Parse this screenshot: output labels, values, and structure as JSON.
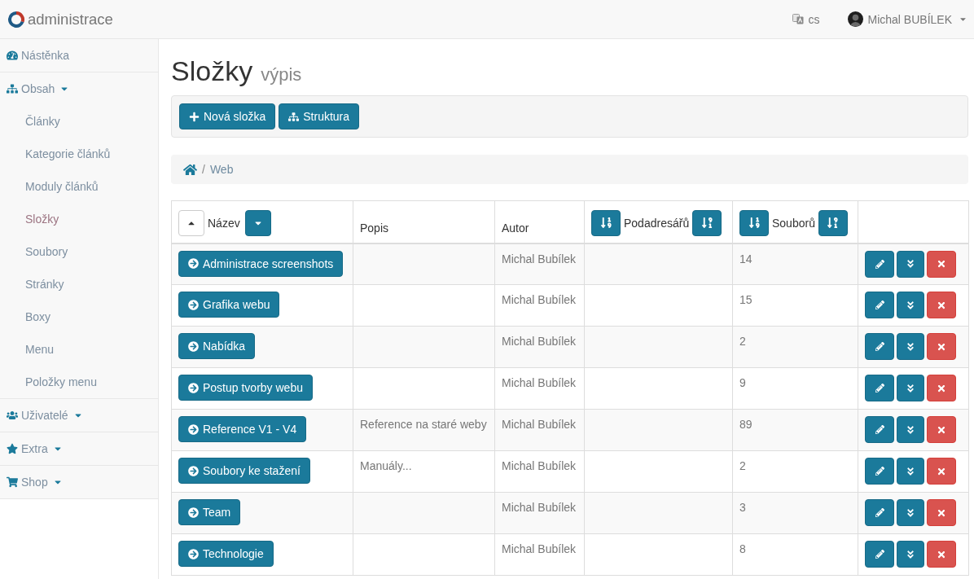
{
  "navbar": {
    "brand": "administrace",
    "language": "cs",
    "user": "Michal BUBÍLEK"
  },
  "sidebar": {
    "items": [
      {
        "label": "Nástěnka",
        "kind": "link"
      },
      {
        "label": "Obsah",
        "kind": "menu",
        "expanded": true,
        "children": [
          {
            "label": "Články",
            "selected": false
          },
          {
            "label": "Kategorie článků",
            "selected": false
          },
          {
            "label": "Moduly článků",
            "selected": false
          },
          {
            "label": "Složky",
            "selected": true
          },
          {
            "label": "Soubory",
            "selected": false
          },
          {
            "label": "Stránky",
            "selected": false
          },
          {
            "label": "Boxy",
            "selected": false
          },
          {
            "label": "Menu",
            "selected": false
          },
          {
            "label": "Položky menu",
            "selected": false
          }
        ]
      },
      {
        "label": "Uživatelé",
        "kind": "menu"
      },
      {
        "label": "Extra",
        "kind": "menu"
      },
      {
        "label": "Shop",
        "kind": "menu"
      }
    ]
  },
  "page_header": {
    "title": "Složky",
    "subtitle": "výpis"
  },
  "toolbar": {
    "buttons": [
      {
        "label": "Nová složka"
      },
      {
        "label": "Struktura"
      }
    ]
  },
  "breadcrumb": {
    "separator": "/",
    "items": [
      {
        "kind": "home"
      },
      {
        "kind": "text",
        "label": "Web"
      }
    ]
  },
  "table": {
    "columns": [
      {
        "label": "Název",
        "kind": "sortable",
        "sorted_ascending": true
      },
      {
        "label": "Popis",
        "kind": "plain"
      },
      {
        "label": "Autor",
        "kind": "plain"
      },
      {
        "label": "Podadresářů",
        "kind": "numeric-sortable"
      },
      {
        "label": "Souborů",
        "kind": "numeric-sortable"
      },
      {
        "kind": "actions"
      }
    ],
    "rows": [
      {
        "name": "Administrace screenshots",
        "author": "Michal Bubílek",
        "files": "14"
      },
      {
        "name": "Grafika webu",
        "author": "Michal Bubílek",
        "files": "15"
      },
      {
        "name": "Nabídka",
        "author": "Michal Bubílek",
        "files": "2"
      },
      {
        "name": "Postup tvorby webu",
        "author": "Michal Bubílek",
        "files": "9"
      },
      {
        "name": "Reference V1 - V4",
        "description": "Reference na staré weby",
        "author": "Michal Bubílek",
        "files": "89"
      },
      {
        "name": "Soubory ke stažení",
        "description": "Manuály...",
        "author": "Michal Bubílek",
        "files": "2"
      },
      {
        "name": "Team",
        "author": "Michal Bubílek",
        "files": "3"
      },
      {
        "name": "Technologie",
        "author": "Michal Bubílek",
        "files": "8"
      }
    ]
  }
}
